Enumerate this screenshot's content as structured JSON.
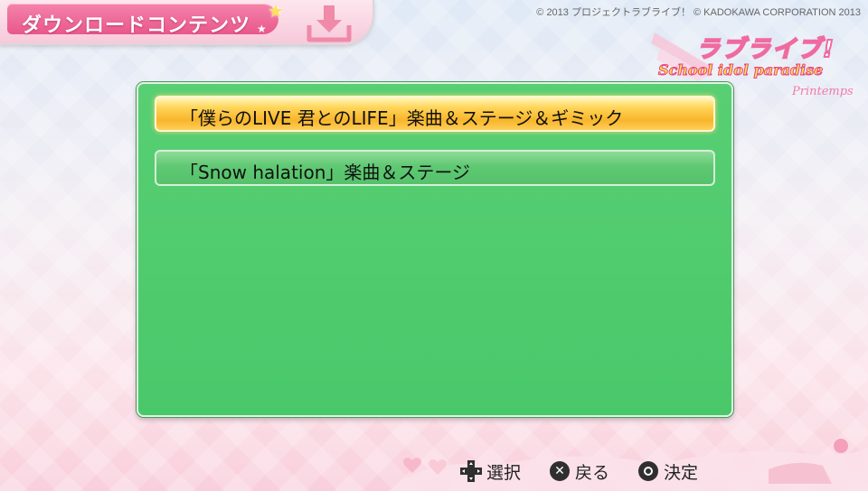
{
  "header": {
    "title": "ダウンロードコンテンツ",
    "download_icon": "download-tray-icon"
  },
  "copyright": "© 2013 プロジェクトラブライブ！ © KADOKAWA CORPORATION 2013",
  "logo": {
    "jp": "ラブライブ!",
    "en": "School idol paradise",
    "sub": "Printemps"
  },
  "menu": {
    "items": [
      {
        "label": "「僕らのLIVE 君とのLIFE」楽曲＆ステージ＆ギミック",
        "selected": true
      },
      {
        "label": "「Snow halation」楽曲＆ステージ",
        "selected": false
      }
    ]
  },
  "footer": {
    "select_label": "選択",
    "back_label": "戻る",
    "confirm_label": "決定"
  },
  "colors": {
    "panel": "#4cc96c",
    "highlight": "#f8b52a",
    "header_pink": "#e9578b"
  }
}
